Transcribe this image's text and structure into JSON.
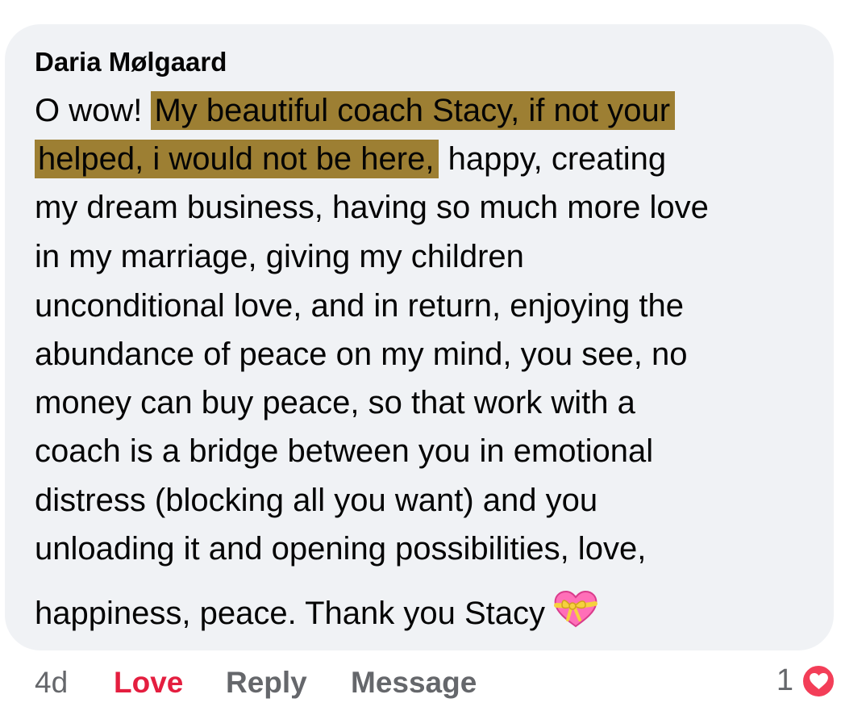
{
  "comment": {
    "author": "Daria Mølgaard",
    "lines": [
      {
        "before": "O wow! ",
        "highlight": "My beautiful coach Stacy, if not your",
        "after": ""
      },
      {
        "before": "",
        "highlight": "helped, i would not be here,",
        "after": " happy, creating"
      },
      {
        "before": "my dream business, having so much more love",
        "highlight": "",
        "after": ""
      },
      {
        "before": "in my marriage, giving my children",
        "highlight": "",
        "after": ""
      },
      {
        "before": "unconditional love, and in return, enjoying the",
        "highlight": "",
        "after": ""
      },
      {
        "before": "abundance of peace on my mind, you see, no",
        "highlight": "",
        "after": ""
      },
      {
        "before": "money can buy peace, so that work with a",
        "highlight": "",
        "after": ""
      },
      {
        "before": "coach is a bridge between you in emotional",
        "highlight": "",
        "after": ""
      },
      {
        "before": "distress (blocking all you want) and you",
        "highlight": "",
        "after": ""
      },
      {
        "before": "unloading it and opening possibilities, love,",
        "highlight": "",
        "after": ""
      },
      {
        "before": "happiness, peace. Thank you Stacy",
        "highlight": "",
        "after": ""
      }
    ],
    "emoji_icon": "heart-with-ribbon-icon",
    "highlight_color": "#9d7f33"
  },
  "actions": {
    "timestamp": "4d",
    "love_label": "Love",
    "reply_label": "Reply",
    "message_label": "Message"
  },
  "reactions": {
    "count": "1",
    "icon": "heart-reaction-icon",
    "color": "#f33e58"
  },
  "colors": {
    "bubble_background": "#f0f2f5",
    "love_red": "#e41e3f",
    "muted_text": "#65676b"
  }
}
